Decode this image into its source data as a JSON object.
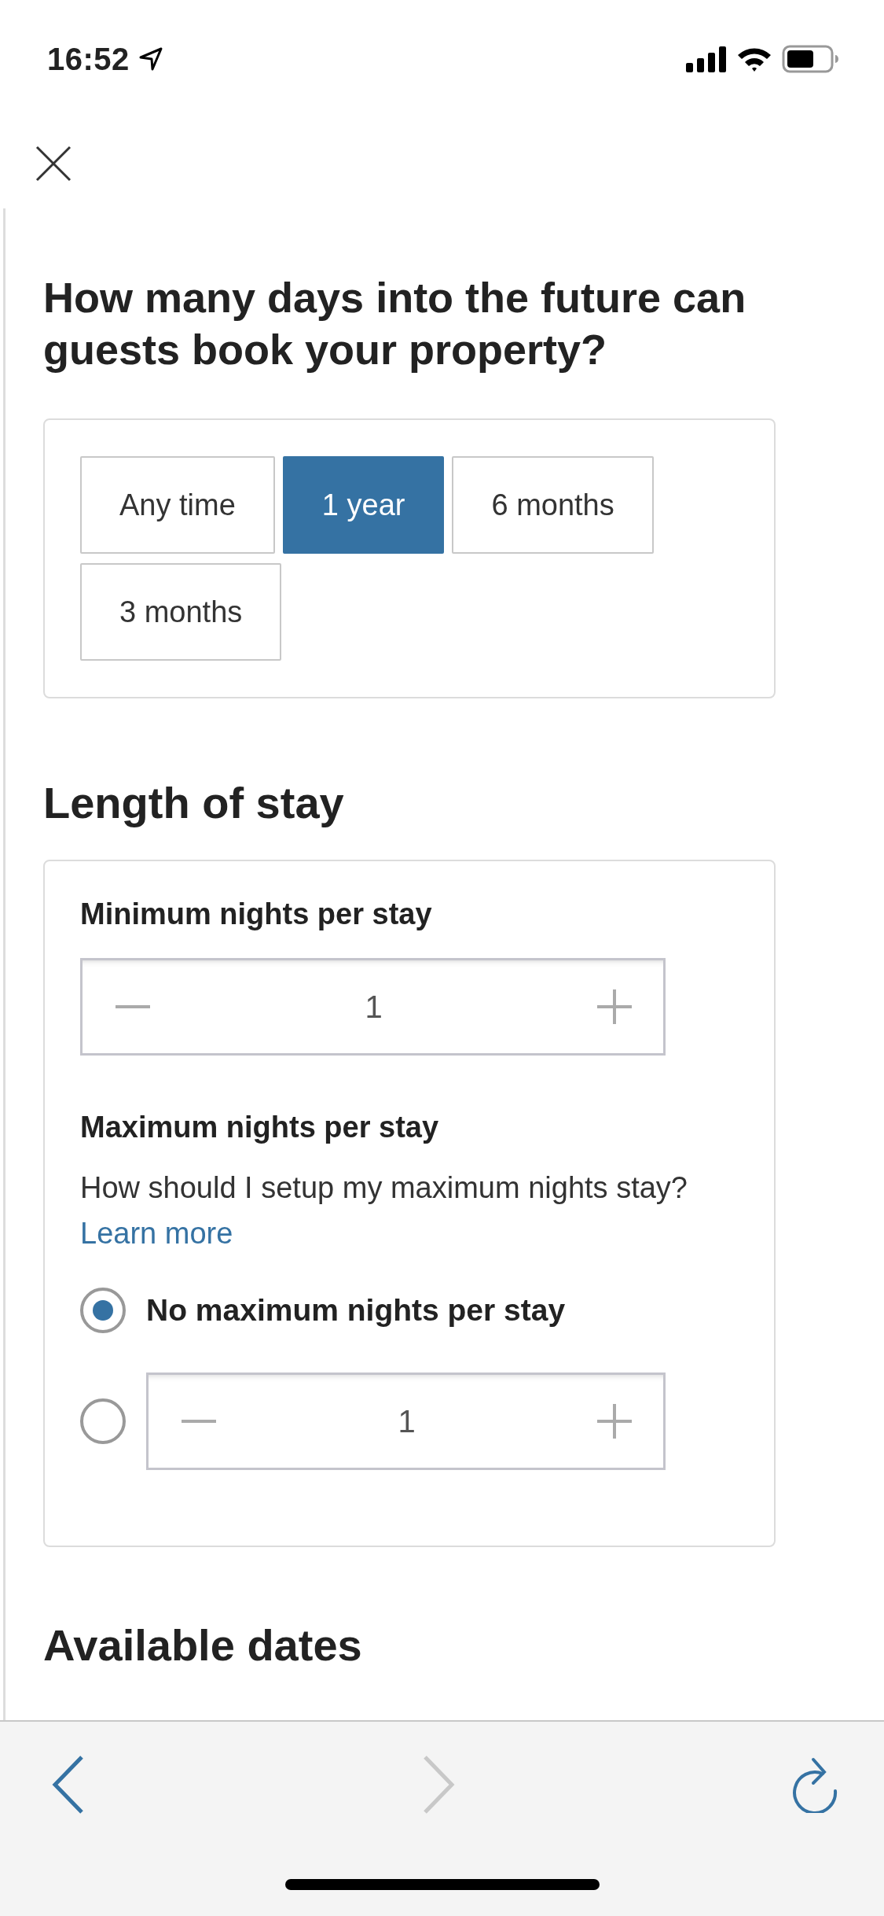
{
  "status_bar": {
    "time": "16:52"
  },
  "title": "How many days into the future can guests book your property?",
  "booking_window": {
    "options": [
      {
        "label": "Any time",
        "selected": false
      },
      {
        "label": "1 year",
        "selected": true
      },
      {
        "label": "6 months",
        "selected": false
      },
      {
        "label": "3 months",
        "selected": false
      }
    ]
  },
  "length_of_stay": {
    "heading": "Length of stay",
    "minimum": {
      "label": "Minimum nights per stay",
      "value": "1"
    },
    "maximum": {
      "label": "Maximum nights per stay",
      "help": "How should I setup my maximum nights stay?",
      "link": "Learn more",
      "options": [
        {
          "kind": "text",
          "label": "No maximum nights per stay",
          "selected": true
        },
        {
          "kind": "stepper",
          "value": "1",
          "selected": false
        }
      ]
    }
  },
  "next_heading": "Available dates",
  "browser_toolbar": {
    "back_disabled": false,
    "forward_disabled": true
  }
}
